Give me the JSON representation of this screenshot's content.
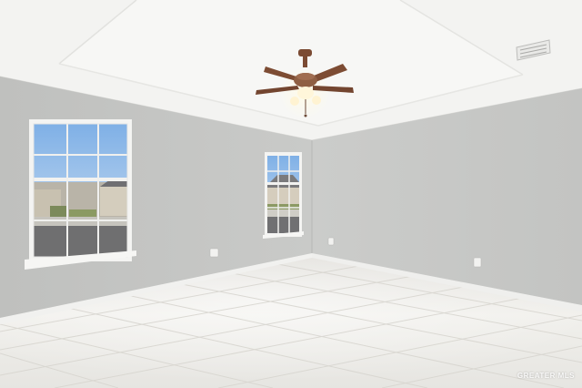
{
  "watermark": {
    "text": "GREATER MLS"
  },
  "colors": {
    "ceiling": "#f4f4f2",
    "left_wall": "#c3c4c2",
    "right_wall": "#c9cac8",
    "floor": "#ecebe7",
    "baseboard": "#f2f2f0",
    "sky": "#9ec3e8",
    "fan_wood": "#7a4a32",
    "fan_metal": "#8d6248"
  },
  "icons": [
    "ceiling-fan-icon",
    "air-vent-icon",
    "outlet-icon",
    "window-icon"
  ]
}
